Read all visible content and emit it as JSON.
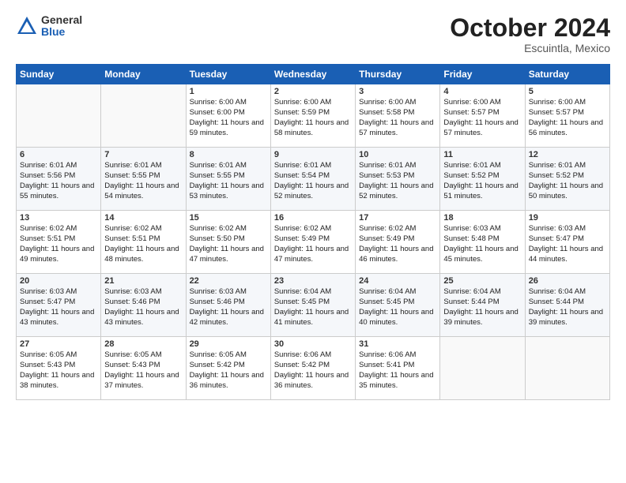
{
  "logo": {
    "general": "General",
    "blue": "Blue"
  },
  "header": {
    "month": "October 2024",
    "location": "Escuintla, Mexico"
  },
  "weekdays": [
    "Sunday",
    "Monday",
    "Tuesday",
    "Wednesday",
    "Thursday",
    "Friday",
    "Saturday"
  ],
  "weeks": [
    [
      {
        "day": "",
        "text": ""
      },
      {
        "day": "",
        "text": ""
      },
      {
        "day": "1",
        "text": "Sunrise: 6:00 AM\nSunset: 6:00 PM\nDaylight: 11 hours and 59 minutes."
      },
      {
        "day": "2",
        "text": "Sunrise: 6:00 AM\nSunset: 5:59 PM\nDaylight: 11 hours and 58 minutes."
      },
      {
        "day": "3",
        "text": "Sunrise: 6:00 AM\nSunset: 5:58 PM\nDaylight: 11 hours and 57 minutes."
      },
      {
        "day": "4",
        "text": "Sunrise: 6:00 AM\nSunset: 5:57 PM\nDaylight: 11 hours and 57 minutes."
      },
      {
        "day": "5",
        "text": "Sunrise: 6:00 AM\nSunset: 5:57 PM\nDaylight: 11 hours and 56 minutes."
      }
    ],
    [
      {
        "day": "6",
        "text": "Sunrise: 6:01 AM\nSunset: 5:56 PM\nDaylight: 11 hours and 55 minutes."
      },
      {
        "day": "7",
        "text": "Sunrise: 6:01 AM\nSunset: 5:55 PM\nDaylight: 11 hours and 54 minutes."
      },
      {
        "day": "8",
        "text": "Sunrise: 6:01 AM\nSunset: 5:55 PM\nDaylight: 11 hours and 53 minutes."
      },
      {
        "day": "9",
        "text": "Sunrise: 6:01 AM\nSunset: 5:54 PM\nDaylight: 11 hours and 52 minutes."
      },
      {
        "day": "10",
        "text": "Sunrise: 6:01 AM\nSunset: 5:53 PM\nDaylight: 11 hours and 52 minutes."
      },
      {
        "day": "11",
        "text": "Sunrise: 6:01 AM\nSunset: 5:52 PM\nDaylight: 11 hours and 51 minutes."
      },
      {
        "day": "12",
        "text": "Sunrise: 6:01 AM\nSunset: 5:52 PM\nDaylight: 11 hours and 50 minutes."
      }
    ],
    [
      {
        "day": "13",
        "text": "Sunrise: 6:02 AM\nSunset: 5:51 PM\nDaylight: 11 hours and 49 minutes."
      },
      {
        "day": "14",
        "text": "Sunrise: 6:02 AM\nSunset: 5:51 PM\nDaylight: 11 hours and 48 minutes."
      },
      {
        "day": "15",
        "text": "Sunrise: 6:02 AM\nSunset: 5:50 PM\nDaylight: 11 hours and 47 minutes."
      },
      {
        "day": "16",
        "text": "Sunrise: 6:02 AM\nSunset: 5:49 PM\nDaylight: 11 hours and 47 minutes."
      },
      {
        "day": "17",
        "text": "Sunrise: 6:02 AM\nSunset: 5:49 PM\nDaylight: 11 hours and 46 minutes."
      },
      {
        "day": "18",
        "text": "Sunrise: 6:03 AM\nSunset: 5:48 PM\nDaylight: 11 hours and 45 minutes."
      },
      {
        "day": "19",
        "text": "Sunrise: 6:03 AM\nSunset: 5:47 PM\nDaylight: 11 hours and 44 minutes."
      }
    ],
    [
      {
        "day": "20",
        "text": "Sunrise: 6:03 AM\nSunset: 5:47 PM\nDaylight: 11 hours and 43 minutes."
      },
      {
        "day": "21",
        "text": "Sunrise: 6:03 AM\nSunset: 5:46 PM\nDaylight: 11 hours and 43 minutes."
      },
      {
        "day": "22",
        "text": "Sunrise: 6:03 AM\nSunset: 5:46 PM\nDaylight: 11 hours and 42 minutes."
      },
      {
        "day": "23",
        "text": "Sunrise: 6:04 AM\nSunset: 5:45 PM\nDaylight: 11 hours and 41 minutes."
      },
      {
        "day": "24",
        "text": "Sunrise: 6:04 AM\nSunset: 5:45 PM\nDaylight: 11 hours and 40 minutes."
      },
      {
        "day": "25",
        "text": "Sunrise: 6:04 AM\nSunset: 5:44 PM\nDaylight: 11 hours and 39 minutes."
      },
      {
        "day": "26",
        "text": "Sunrise: 6:04 AM\nSunset: 5:44 PM\nDaylight: 11 hours and 39 minutes."
      }
    ],
    [
      {
        "day": "27",
        "text": "Sunrise: 6:05 AM\nSunset: 5:43 PM\nDaylight: 11 hours and 38 minutes."
      },
      {
        "day": "28",
        "text": "Sunrise: 6:05 AM\nSunset: 5:43 PM\nDaylight: 11 hours and 37 minutes."
      },
      {
        "day": "29",
        "text": "Sunrise: 6:05 AM\nSunset: 5:42 PM\nDaylight: 11 hours and 36 minutes."
      },
      {
        "day": "30",
        "text": "Sunrise: 6:06 AM\nSunset: 5:42 PM\nDaylight: 11 hours and 36 minutes."
      },
      {
        "day": "31",
        "text": "Sunrise: 6:06 AM\nSunset: 5:41 PM\nDaylight: 11 hours and 35 minutes."
      },
      {
        "day": "",
        "text": ""
      },
      {
        "day": "",
        "text": ""
      }
    ]
  ]
}
